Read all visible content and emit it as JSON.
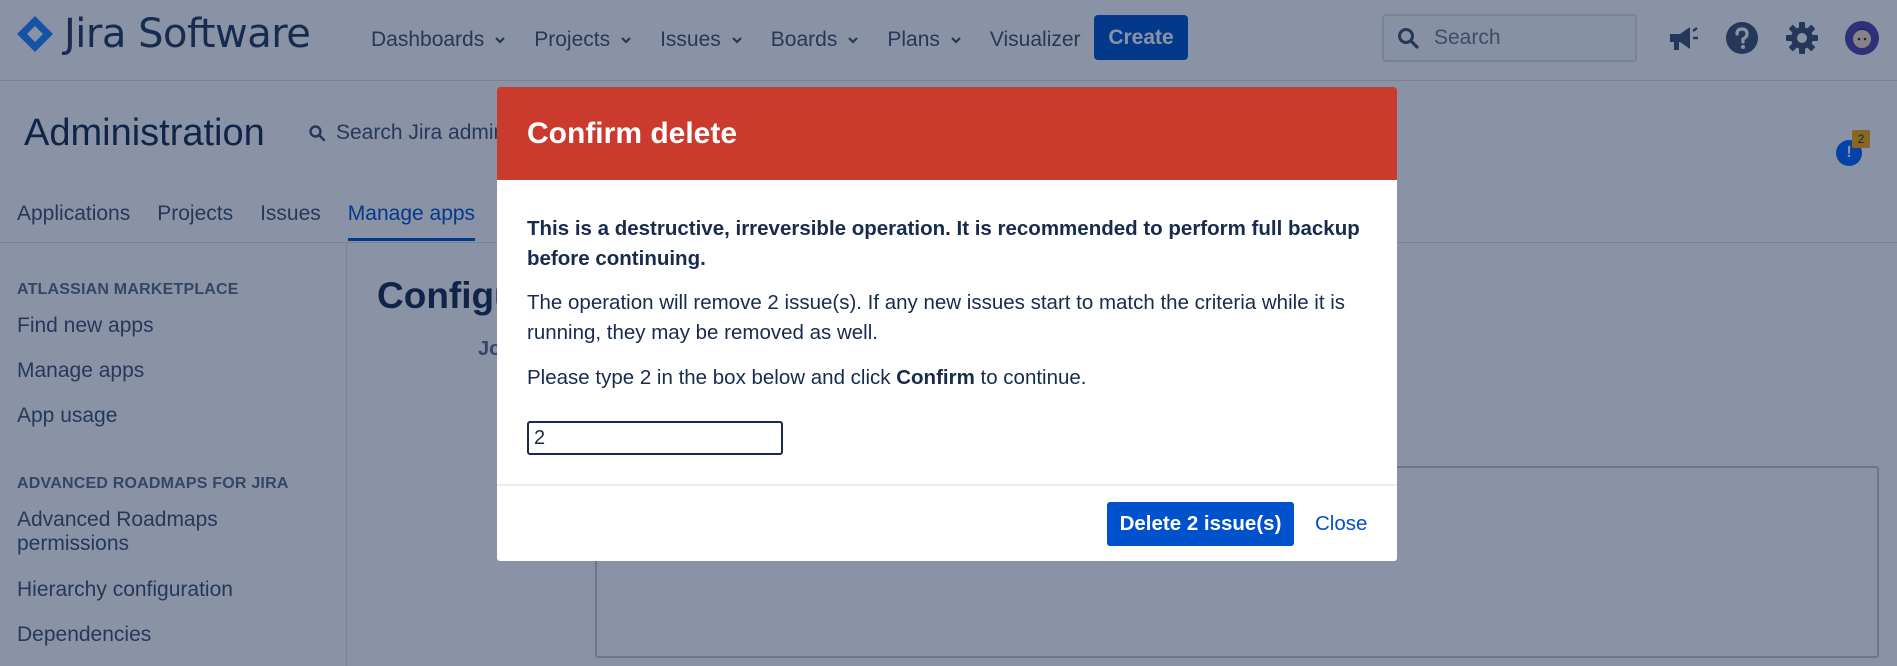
{
  "topnav": {
    "logo_text": "Jira Software",
    "items": [
      {
        "label": "Dashboards",
        "dropdown": true
      },
      {
        "label": "Projects",
        "dropdown": true
      },
      {
        "label": "Issues",
        "dropdown": true
      },
      {
        "label": "Boards",
        "dropdown": true
      },
      {
        "label": "Plans",
        "dropdown": true
      },
      {
        "label": "Visualizer",
        "dropdown": false
      }
    ],
    "create_label": "Create",
    "search_placeholder": "Search",
    "icons": [
      "megaphone-icon",
      "help-icon",
      "settings-icon",
      "avatar"
    ]
  },
  "admin": {
    "title": "Administration",
    "search_label": "Search Jira admin",
    "tabs": [
      "Applications",
      "Projects",
      "Issues",
      "Manage apps"
    ],
    "active_tab": "Manage apps",
    "notification_count": "2"
  },
  "sidebar": {
    "sections": [
      {
        "heading": "ATLASSIAN MARKETPLACE",
        "items": [
          "Find new apps",
          "Manage apps",
          "App usage"
        ]
      },
      {
        "heading": "ADVANCED ROADMAPS FOR JIRA",
        "items": [
          "Advanced Roadmaps permissions",
          "Hierarchy configuration",
          "Dependencies"
        ]
      }
    ]
  },
  "main": {
    "heading": "Configu",
    "field_label": "Jo"
  },
  "dialog": {
    "title": "Confirm delete",
    "warning": "This is a destructive, irreversible operation. It is recommended to perform full backup before continuing.",
    "info": "The operation will remove 2 issue(s). If any new issues start to match the criteria while it is running, they may be removed as well.",
    "confirm_prefix": "Please type 2 in the box below and click ",
    "confirm_bold": "Confirm",
    "confirm_suffix": " to continue.",
    "input_value": "2",
    "delete_label": "Delete 2 issue(s)",
    "close_label": "Close"
  },
  "colors": {
    "brand": "#0052cc",
    "danger_header": "#ca3a2d",
    "overlay": "rgba(9,30,66,0.48)"
  }
}
